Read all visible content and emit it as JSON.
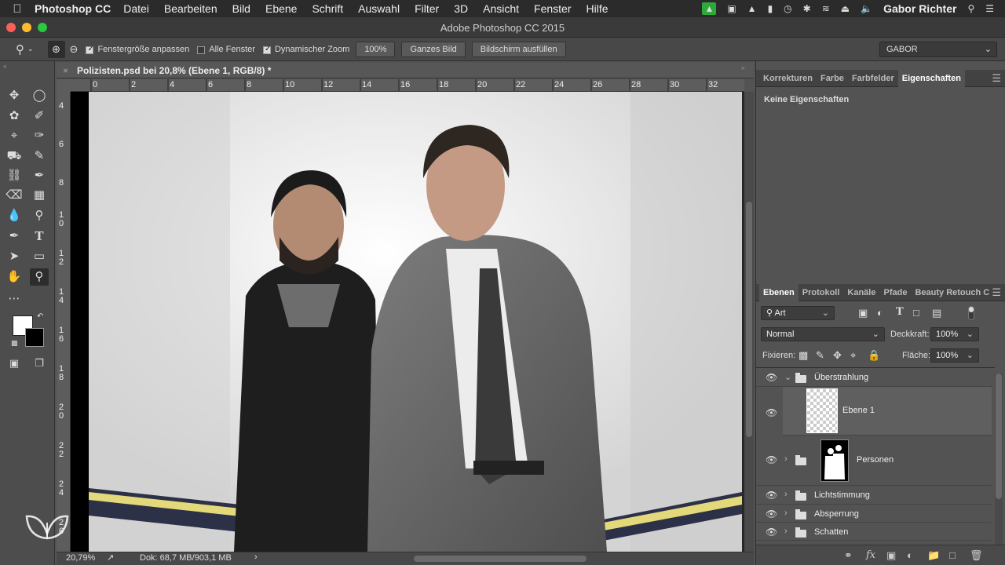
{
  "menubar": {
    "app": "Photoshop CC",
    "items": [
      "Datei",
      "Bearbeiten",
      "Bild",
      "Ebene",
      "Schrift",
      "Auswahl",
      "Filter",
      "3D",
      "Ansicht",
      "Fenster",
      "Hilfe"
    ],
    "user": "Gabor Richter"
  },
  "window": {
    "title": "Adobe Photoshop CC 2015"
  },
  "options": {
    "fit_window": "Fenstergröße anpassen",
    "all_windows": "Alle Fenster",
    "dynamic_zoom": "Dynamischer Zoom",
    "zoom_value": "100%",
    "whole_image": "Ganzes Bild",
    "fill_screen": "Bildschirm ausfüllen",
    "workspace": "GABOR"
  },
  "document": {
    "tab_title": "Polizisten.psd bei 20,8% (Ebene 1, RGB/8) *",
    "ruler_h": [
      "0",
      "2",
      "4",
      "6",
      "8",
      "10",
      "12",
      "14",
      "16",
      "18",
      "20",
      "22",
      "24",
      "26",
      "28",
      "30",
      "32"
    ],
    "ruler_v": [
      "4",
      "6",
      "8",
      "1\n0",
      "1\n2",
      "1\n4",
      "1\n6",
      "1\n8",
      "2\n0",
      "2\n2",
      "2\n4",
      "2\n6"
    ]
  },
  "status": {
    "zoom": "20,79%",
    "doc_info": "Dok: 68,7 MB/903,1 MB"
  },
  "panels": {
    "top_tabs": [
      "Korrekturen",
      "Farbe",
      "Farbfelder",
      "Eigenschaften"
    ],
    "properties_empty": "Keine Eigenschaften",
    "layer_tabs": [
      "Ebenen",
      "Protokoll",
      "Kanäle",
      "Pfade",
      "Beauty Retouch C"
    ],
    "filter_kind": "Art",
    "blend_mode": "Normal",
    "opacity_label": "Deckkraft:",
    "opacity_value": "100%",
    "lock_label": "Fixieren:",
    "fill_label": "Fläche:",
    "fill_value": "100%"
  },
  "layers": [
    {
      "name": "Überstrahlung",
      "type": "group",
      "expanded": true
    },
    {
      "name": "Ebene 1",
      "type": "layer",
      "selected": true
    },
    {
      "name": "Personen",
      "type": "group"
    },
    {
      "name": "Lichtstimmung",
      "type": "group"
    },
    {
      "name": "Absperrung",
      "type": "group"
    },
    {
      "name": "Schatten",
      "type": "group"
    }
  ],
  "colors": {
    "accent_selected": "#5f5f5f",
    "tape_yellow": "#e3d97a",
    "tape_dark": "#2d3148"
  }
}
